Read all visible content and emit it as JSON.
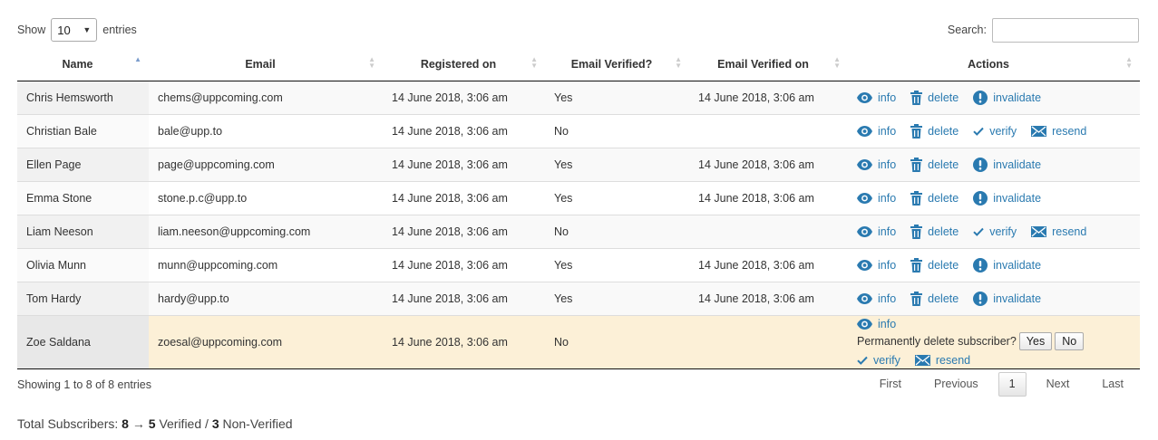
{
  "length": {
    "show": "Show",
    "value": "10",
    "entries": "entries"
  },
  "search": {
    "label": "Search:",
    "value": ""
  },
  "columns": [
    "Name",
    "Email",
    "Registered on",
    "Email Verified?",
    "Email Verified on",
    "Actions"
  ],
  "sorted_column": "Name",
  "rows": [
    {
      "name": "Chris Hemsworth",
      "email": "chems@uppcoming.com",
      "registered": "14 June 2018, 3:06 am",
      "verified": "Yes",
      "verified_on": "14 June 2018, 3:06 am",
      "actions": [
        "info",
        "delete",
        "invalidate"
      ]
    },
    {
      "name": "Christian Bale",
      "email": "bale@upp.to",
      "registered": "14 June 2018, 3:06 am",
      "verified": "No",
      "verified_on": "",
      "actions": [
        "info",
        "delete",
        "verify",
        "resend"
      ]
    },
    {
      "name": "Ellen Page",
      "email": "page@uppcoming.com",
      "registered": "14 June 2018, 3:06 am",
      "verified": "Yes",
      "verified_on": "14 June 2018, 3:06 am",
      "actions": [
        "info",
        "delete",
        "invalidate"
      ]
    },
    {
      "name": "Emma Stone",
      "email": "stone.p.c@upp.to",
      "registered": "14 June 2018, 3:06 am",
      "verified": "Yes",
      "verified_on": "14 June 2018, 3:06 am",
      "actions": [
        "info",
        "delete",
        "invalidate"
      ]
    },
    {
      "name": "Liam Neeson",
      "email": "liam.neeson@uppcoming.com",
      "registered": "14 June 2018, 3:06 am",
      "verified": "No",
      "verified_on": "",
      "actions": [
        "info",
        "delete",
        "verify",
        "resend"
      ]
    },
    {
      "name": "Olivia Munn",
      "email": "munn@uppcoming.com",
      "registered": "14 June 2018, 3:06 am",
      "verified": "Yes",
      "verified_on": "14 June 2018, 3:06 am",
      "actions": [
        "info",
        "delete",
        "invalidate"
      ]
    },
    {
      "name": "Tom Hardy",
      "email": "hardy@upp.to",
      "registered": "14 June 2018, 3:06 am",
      "verified": "Yes",
      "verified_on": "14 June 2018, 3:06 am",
      "actions": [
        "info",
        "delete",
        "invalidate"
      ]
    },
    {
      "name": "Zoe Saldana",
      "email": "zoesal@uppcoming.com",
      "registered": "14 June 2018, 3:06 am",
      "verified": "No",
      "verified_on": "",
      "actions": [
        "info",
        "confirm",
        "verify",
        "resend"
      ],
      "highlighted": true
    }
  ],
  "confirm": {
    "text": "Permanently delete subscriber?",
    "yes": "Yes",
    "no": "No"
  },
  "action_labels": {
    "info": "info",
    "delete": "delete",
    "invalidate": "invalidate",
    "verify": "verify",
    "resend": "resend"
  },
  "footer": {
    "info": "Showing 1 to 8 of 8 entries",
    "paging": {
      "first": "First",
      "previous": "Previous",
      "current": "1",
      "next": "Next",
      "last": "Last"
    }
  },
  "totals": {
    "label": "Total Subscribers:",
    "total": "8",
    "arrow": "→",
    "verified": "5",
    "verified_label": "Verified",
    "sep": "/",
    "nonverified": "3",
    "nonverified_label": "Non-Verified"
  },
  "colors": {
    "link": "#2a7ab0",
    "highlight_row": "#fcf0d7"
  }
}
